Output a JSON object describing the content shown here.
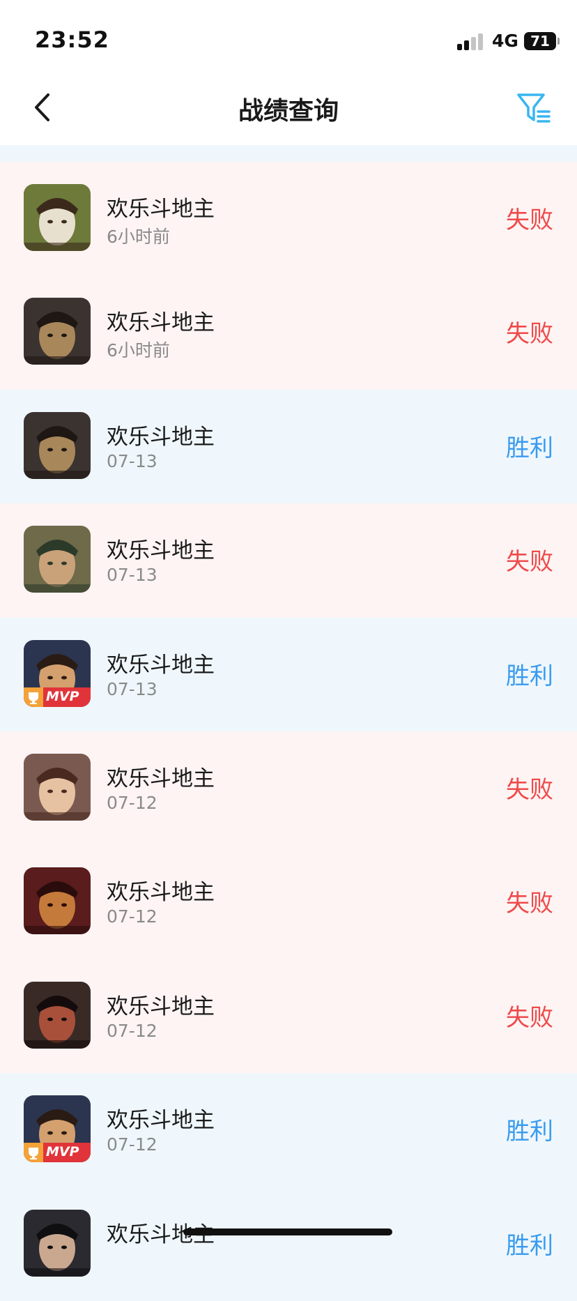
{
  "status_bar": {
    "time": "23:52",
    "network": "4G",
    "battery": "71"
  },
  "header": {
    "title": "战绩查询",
    "back_icon": "chevron-left-icon",
    "filter_icon": "filter-icon"
  },
  "colors": {
    "loss_text": "#ee4b4b",
    "win_text": "#3a9bef",
    "loss_bg": "#fef4f4",
    "win_bg": "#eff7fc",
    "filter_icon": "#38b6f0"
  },
  "records": [
    {
      "title": "欢乐斗地主",
      "time": "6小时前",
      "result": "失败",
      "outcome": "loss",
      "mvp": false,
      "mvp_label": ""
    },
    {
      "title": "欢乐斗地主",
      "time": "6小时前",
      "result": "失败",
      "outcome": "loss",
      "mvp": false,
      "mvp_label": ""
    },
    {
      "title": "欢乐斗地主",
      "time": "07-13",
      "result": "胜利",
      "outcome": "win",
      "mvp": false,
      "mvp_label": ""
    },
    {
      "title": "欢乐斗地主",
      "time": "07-13",
      "result": "失败",
      "outcome": "loss",
      "mvp": false,
      "mvp_label": ""
    },
    {
      "title": "欢乐斗地主",
      "time": "07-13",
      "result": "胜利",
      "outcome": "win",
      "mvp": true,
      "mvp_label": "MVP"
    },
    {
      "title": "欢乐斗地主",
      "time": "07-12",
      "result": "失败",
      "outcome": "loss",
      "mvp": false,
      "mvp_label": ""
    },
    {
      "title": "欢乐斗地主",
      "time": "07-12",
      "result": "失败",
      "outcome": "loss",
      "mvp": false,
      "mvp_label": ""
    },
    {
      "title": "欢乐斗地主",
      "time": "07-12",
      "result": "失败",
      "outcome": "loss",
      "mvp": false,
      "mvp_label": ""
    },
    {
      "title": "欢乐斗地主",
      "time": "07-12",
      "result": "胜利",
      "outcome": "win",
      "mvp": true,
      "mvp_label": "MVP"
    },
    {
      "title": "欢乐斗地主",
      "time": "",
      "result": "胜利",
      "outcome": "win",
      "mvp": false,
      "mvp_label": ""
    }
  ]
}
